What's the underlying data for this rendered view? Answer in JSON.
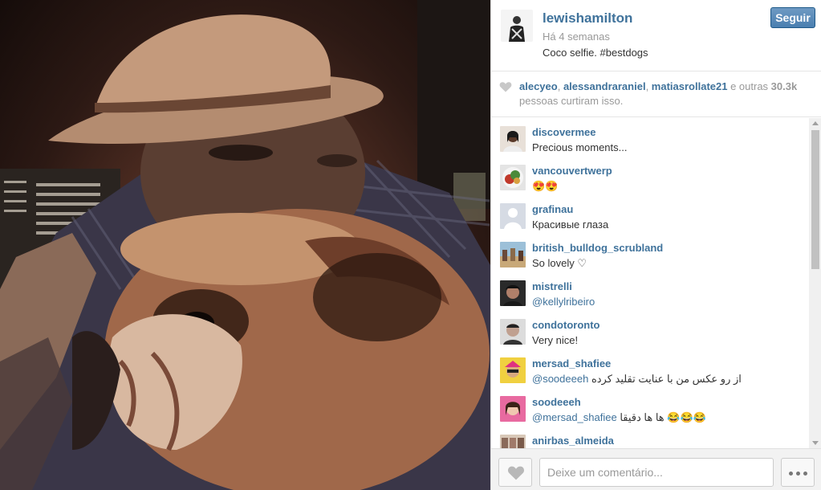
{
  "photo": {
    "alt": "Coco selfie"
  },
  "post": {
    "username": "lewishamilton",
    "time": "Há 4 semanas",
    "caption": "Coco selfie. #bestdogs",
    "follow_label": "Seguir"
  },
  "likes": {
    "users": [
      "alecyeo",
      "alessandraraniel",
      "matiasrollate21"
    ],
    "sep": ", ",
    "others_prefix": " e outras ",
    "count": "30.3k",
    "suffix": "pessoas curtiram isso."
  },
  "comments": [
    {
      "user": "discovermee",
      "text": "Precious moments..."
    },
    {
      "user": "vancouvertwerp",
      "text": "😍😍"
    },
    {
      "user": "grafinau",
      "text": "Красивые глаза"
    },
    {
      "user": "british_bulldog_scrubland",
      "text": "So lovely ♡"
    },
    {
      "user": "mistrelli",
      "mention": "@kellylribeiro",
      "text": ""
    },
    {
      "user": "condotoronto",
      "text": "Very nice!"
    },
    {
      "user": "mersad_shafiee",
      "mention": "@soodeeeh",
      "text": " از رو عکس من با عنایت تقلید کرده"
    },
    {
      "user": "soodeeeh",
      "mention": "@mersad_shafiee",
      "text": " ها ها دقیقا 😂😂😂"
    },
    {
      "user": "anirbas_almeida",
      "text": ""
    }
  ],
  "footer": {
    "comment_placeholder": "Deixe um comentário..."
  },
  "colors": {
    "link": "#3f729b",
    "button": "#4a7fb0",
    "muted": "#999999"
  }
}
